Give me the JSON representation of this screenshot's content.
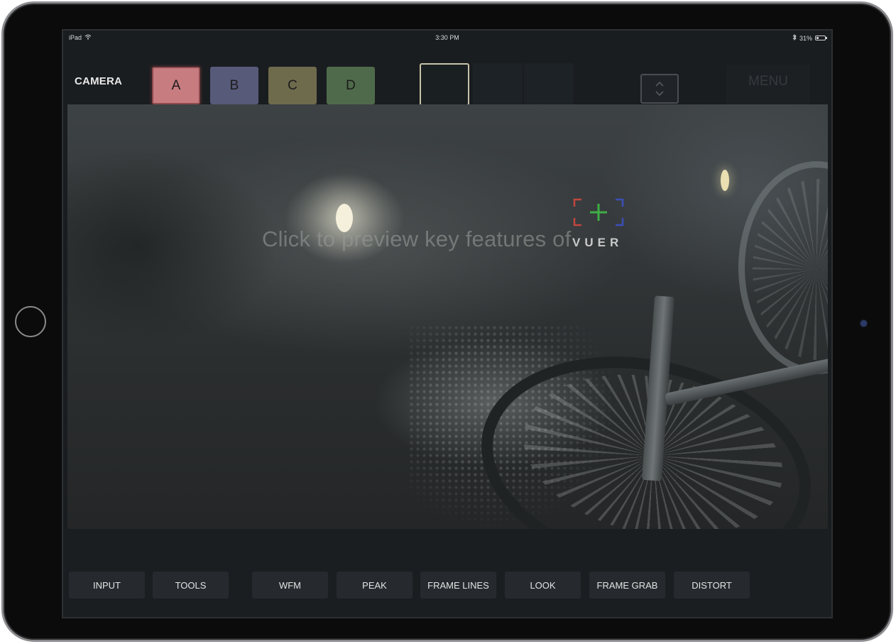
{
  "status": {
    "device": "iPad",
    "time": "3:30 PM",
    "battery": "31%",
    "battery_level": 0.31
  },
  "header": {
    "camera_label": "CAMERA",
    "cameras": [
      {
        "label": "A",
        "color": "#c77c80",
        "selected": true
      },
      {
        "label": "B",
        "color": "#585a7a"
      },
      {
        "label": "C",
        "color": "#6e6a4c"
      },
      {
        "label": "D",
        "color": "#4f6a4a"
      }
    ],
    "menu_label": "MENU"
  },
  "viewer": {
    "preview_text": "Click to preview key features of",
    "brand": "VUER"
  },
  "toolbar": {
    "buttons": [
      "INPUT",
      "TOOLS",
      "WFM",
      "PEAK",
      "FRAME LINES",
      "LOOK",
      "FRAME GRAB",
      "DISTORT"
    ]
  }
}
